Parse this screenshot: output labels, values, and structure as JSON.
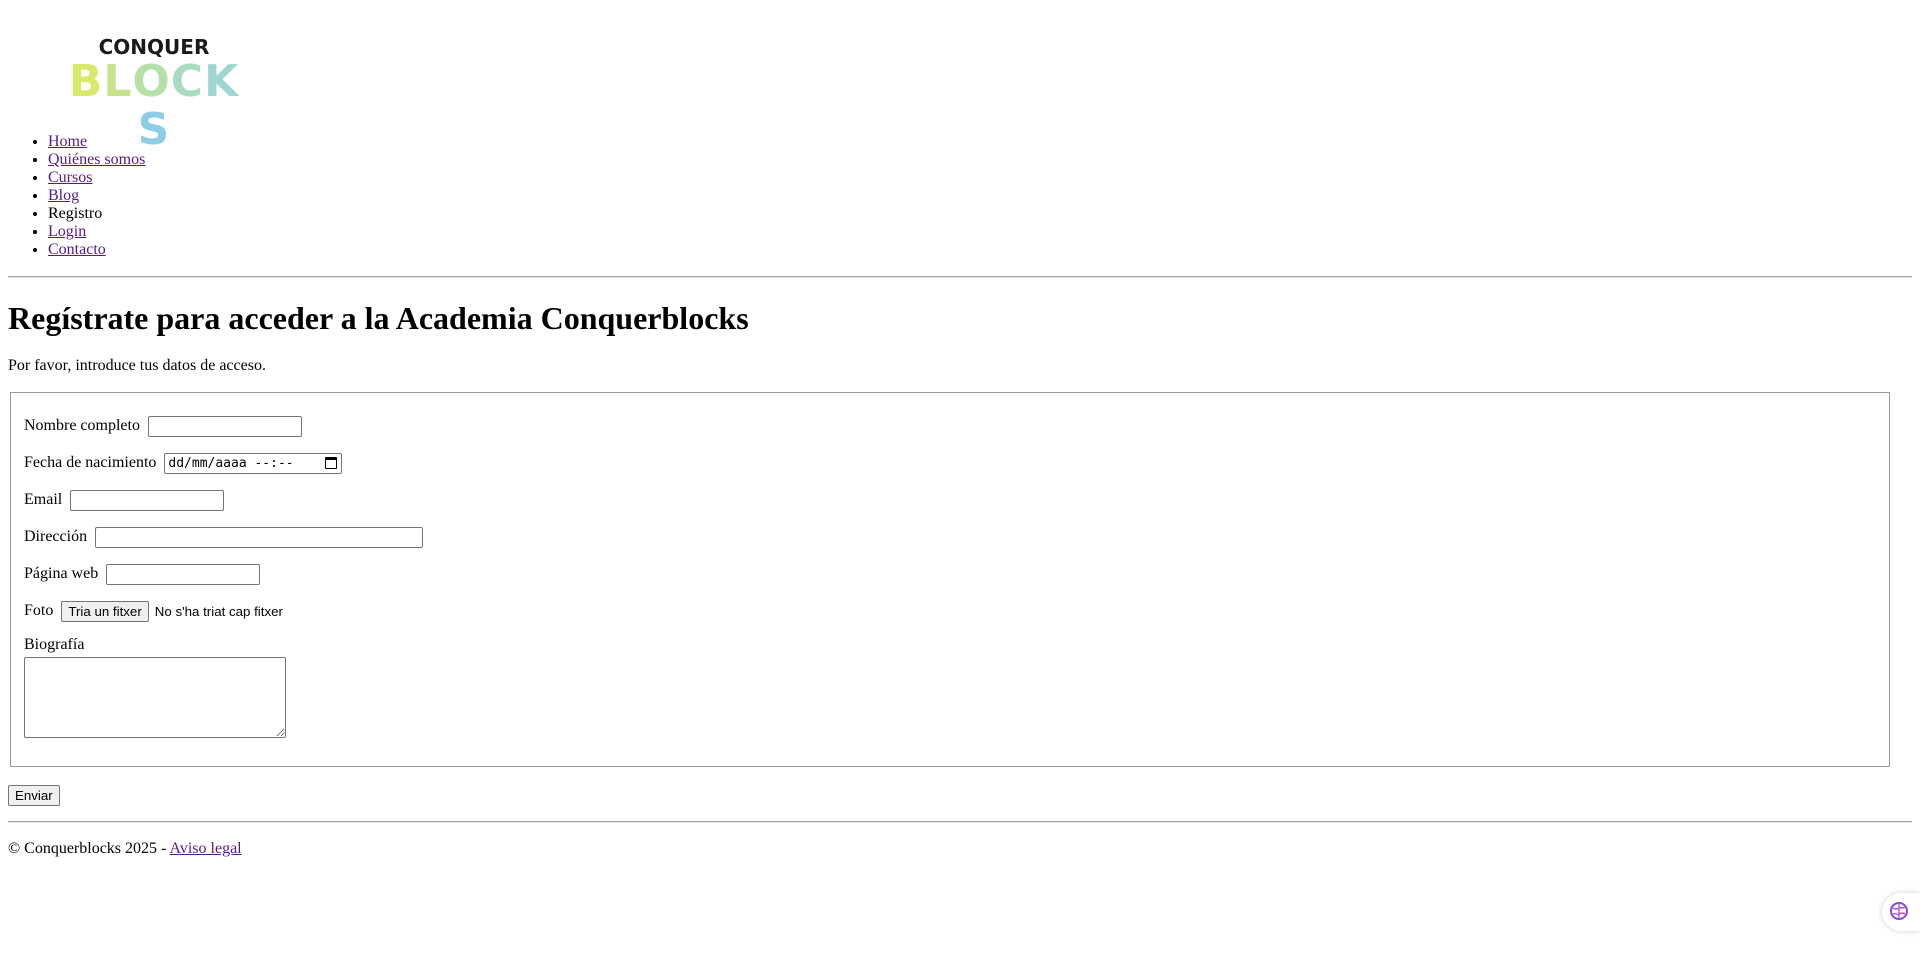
{
  "logo": {
    "top_text": "CONQUER",
    "bottom_letters": [
      {
        "ch": "B",
        "color": "#d9ea6b"
      },
      {
        "ch": "L",
        "color": "#c6e48b"
      },
      {
        "ch": "O",
        "color": "#b5e0a6"
      },
      {
        "ch": "C",
        "color": "#a8dcc0"
      },
      {
        "ch": "K",
        "color": "#9fd6d2"
      },
      {
        "ch": "S",
        "color": "#8fcde6"
      }
    ]
  },
  "nav": {
    "items": [
      {
        "label": "Home",
        "link": true
      },
      {
        "label": "Quiénes somos",
        "link": true
      },
      {
        "label": "Cursos",
        "link": true
      },
      {
        "label": "Blog",
        "link": true
      },
      {
        "label": "Registro",
        "link": false
      },
      {
        "label": "Login",
        "link": true
      },
      {
        "label": "Contacto",
        "link": true
      }
    ]
  },
  "heading": "Regístrate para acceder a la Academia Conquerblocks",
  "intro": "Por favor, introduce tus datos de acceso.",
  "form": {
    "name_label": "Nombre completo",
    "birth_label": "Fecha de nacimiento",
    "birth_placeholder": "dd/mm/aaaa --:--",
    "email_label": "Email",
    "address_label": "Dirección",
    "web_label": "Página web",
    "photo_label": "Foto",
    "file_button": "Tria un fitxer",
    "file_status": "No s'ha triat cap fitxer",
    "bio_label": "Biografía",
    "submit_label": "Enviar"
  },
  "footer": {
    "copyright": "© Conquerblocks 2025 - ",
    "legal_link": "Aviso legal"
  }
}
